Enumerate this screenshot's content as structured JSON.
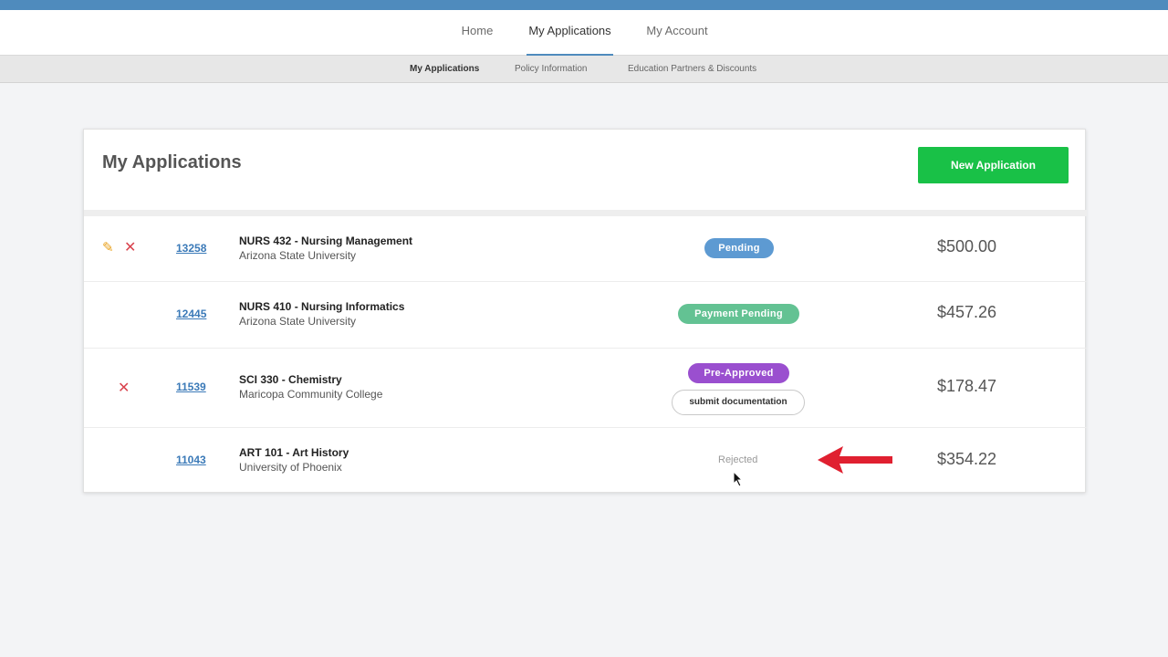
{
  "nav": {
    "items": [
      {
        "label": "Home",
        "active": false
      },
      {
        "label": "My Applications",
        "active": true
      },
      {
        "label": "My Account",
        "active": false
      }
    ]
  },
  "subnav": {
    "items": [
      {
        "label": "My Applications",
        "active": true
      },
      {
        "label": "Policy Information",
        "active": false
      },
      {
        "label": "Education Partners & Discounts",
        "active": false
      }
    ]
  },
  "page": {
    "title": "My Applications",
    "new_button_label": "New Application"
  },
  "applications": [
    {
      "id": "13258",
      "course": "NURS 432 - Nursing Management",
      "school": "Arizona State University",
      "status": "Pending",
      "amount": "$500.00",
      "editable": true,
      "deletable": true
    },
    {
      "id": "12445",
      "course": "NURS 410 - Nursing Informatics",
      "school": "Arizona State University",
      "status": "Payment Pending",
      "amount": "$457.26",
      "editable": false,
      "deletable": false
    },
    {
      "id": "11539",
      "course": "SCI 330 - Chemistry",
      "school": "Maricopa Community College",
      "status": "Pre-Approved",
      "action_label": "submit documentation",
      "amount": "$178.47",
      "editable": false,
      "deletable": true
    },
    {
      "id": "11043",
      "course": "ART 101 - Art History",
      "school": "University of Phoenix",
      "status": "Rejected",
      "amount": "$354.22",
      "editable": false,
      "deletable": false
    }
  ],
  "colors": {
    "accent": "#4f8bbd",
    "new_button": "#19c147",
    "pending": "#5d9ad2",
    "payment_pending": "#63c293",
    "pre_approved": "#9a4fcf",
    "delete": "#d9434e",
    "edit": "#e8a019",
    "annotation_arrow": "#e02030"
  },
  "icons": {
    "edit": "pencil-icon",
    "delete": "close-icon",
    "annotation": "arrow-left-icon",
    "pointer": "mouse-cursor-icon"
  }
}
